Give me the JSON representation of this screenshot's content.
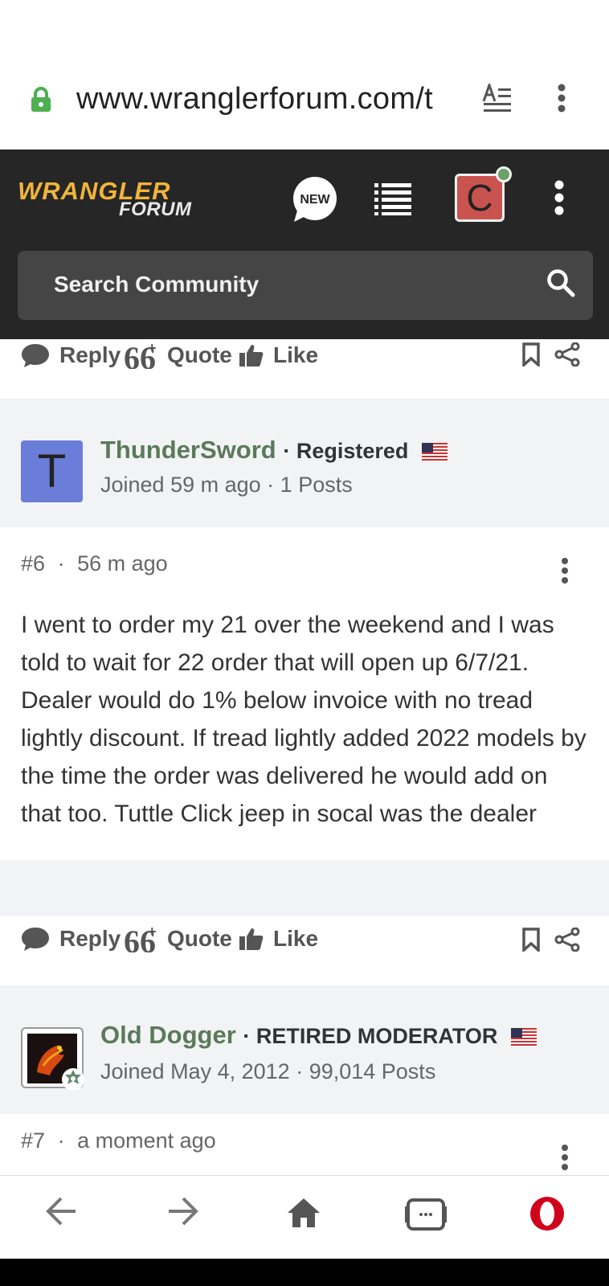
{
  "browser": {
    "url": "www.wranglerforum.com/t",
    "colors": {
      "lock": "#4caf50",
      "opera": "#d0021b"
    }
  },
  "header": {
    "logo_line1": "WRANGLER",
    "logo_line2": "FORUM",
    "new_badge": "NEW",
    "avatar_letter": "C",
    "search_placeholder": "Search Community"
  },
  "actions": {
    "reply": "Reply",
    "quote": "Quote",
    "like": "Like"
  },
  "posts": [
    {
      "author": "ThunderSword",
      "role": "Registered",
      "avatar_letter": "T",
      "joined": "Joined 59 m ago",
      "posts": "1 Posts",
      "number": "#6",
      "time": "56 m ago",
      "body": "I went to order my 21 over the weekend and I was told to wait for 22 order that will open up 6/7/21. Dealer would do 1% below invoice with no tread lightly discount. If tread lightly added 2022 models by the time the order was delivered he would add on that too. Tuttle Click jeep in socal was the dealer"
    },
    {
      "author": "Old Dogger",
      "role": "RETIRED MODERATOR",
      "joined": "Joined May 4, 2012",
      "posts": "99,014 Posts",
      "number": "#7",
      "time": "a moment ago"
    }
  ],
  "separator": "·"
}
